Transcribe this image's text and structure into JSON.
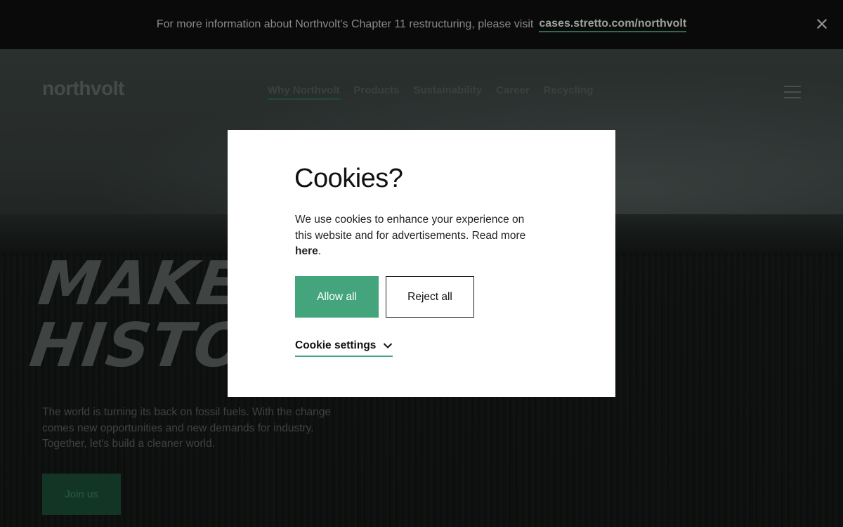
{
  "banner": {
    "message": "For more information about Northvolt’s Chapter 11 restructuring, please visit",
    "link_text": "cases.stretto.com/northvolt"
  },
  "nav": {
    "logo": "northvolt",
    "items": [
      {
        "label": "Why Northvolt",
        "active": true
      },
      {
        "label": "Products"
      },
      {
        "label": "Sustainability"
      },
      {
        "label": "Career"
      },
      {
        "label": "Recycling"
      }
    ]
  },
  "hero": {
    "headline_line1": "MAKE O",
    "headline_line2": "HISTOR",
    "intro": "The world is turning its back on fossil fuels. With the change comes new opportunities and new demands for industry. Together, let's build a cleaner world.",
    "cta": "Join us"
  },
  "cookie_modal": {
    "title": "Cookies?",
    "description_prefix": "We use cookies to enhance your experience on this website and for advertisements. Read more ",
    "description_link": "here",
    "description_suffix": ".",
    "allow_label": "Allow all",
    "reject_label": "Reject all",
    "settings_label": "Cookie settings"
  },
  "colors": {
    "accent_green": "#44a57c",
    "banner_bg": "#0a0a0a",
    "modal_bg": "#ffffff"
  }
}
